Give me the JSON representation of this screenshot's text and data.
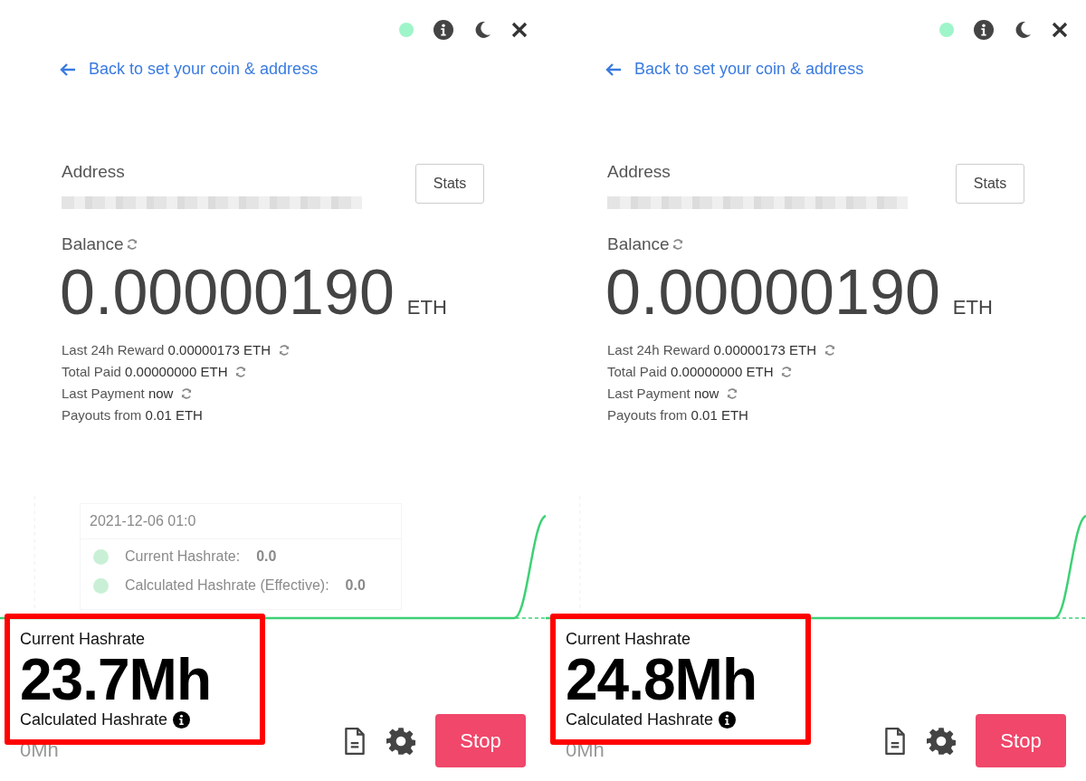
{
  "panels": [
    {
      "back_link": "Back to set your coin & address",
      "address_label": "Address",
      "stats_button": "Stats",
      "balance_label": "Balance",
      "balance": "0.00000190",
      "balance_unit": "ETH",
      "details": [
        {
          "label": "Last 24h Reward",
          "value": "0.00000173 ETH",
          "refresh": true
        },
        {
          "label": "Total Paid",
          "value": "0.00000000 ETH",
          "refresh": true
        },
        {
          "label": "Last Payment",
          "value": "now",
          "refresh": true
        },
        {
          "label": "Payouts from",
          "value": "0.01 ETH",
          "refresh": false
        }
      ],
      "tooltip": {
        "date": "2021-12-06 01:0",
        "rows": [
          {
            "label": "Current Hashrate:",
            "value": "0.0"
          },
          {
            "label": "Calculated Hashrate (Effective):",
            "value": "0.0"
          }
        ]
      },
      "current_label": "Current Hashrate",
      "current_value": "23.7Mh",
      "calculated_label": "Calculated Hashrate",
      "calculated_value": "0Mh",
      "highlighted": true,
      "stop_button": "Stop"
    },
    {
      "back_link": "Back to set your coin & address",
      "address_label": "Address",
      "stats_button": "Stats",
      "balance_label": "Balance",
      "balance": "0.00000190",
      "balance_unit": "ETH",
      "details": [
        {
          "label": "Last 24h Reward",
          "value": "0.00000173 ETH",
          "refresh": true
        },
        {
          "label": "Total Paid",
          "value": "0.00000000 ETH",
          "refresh": true
        },
        {
          "label": "Last Payment",
          "value": "now",
          "refresh": true
        },
        {
          "label": "Payouts from",
          "value": "0.01 ETH",
          "refresh": false
        }
      ],
      "current_label": "Current Hashrate",
      "current_value": "24.8Mh",
      "calculated_label": "Calculated Hashrate",
      "calculated_value": "0Mh",
      "highlighted": true,
      "stop_button": "Stop"
    }
  ]
}
